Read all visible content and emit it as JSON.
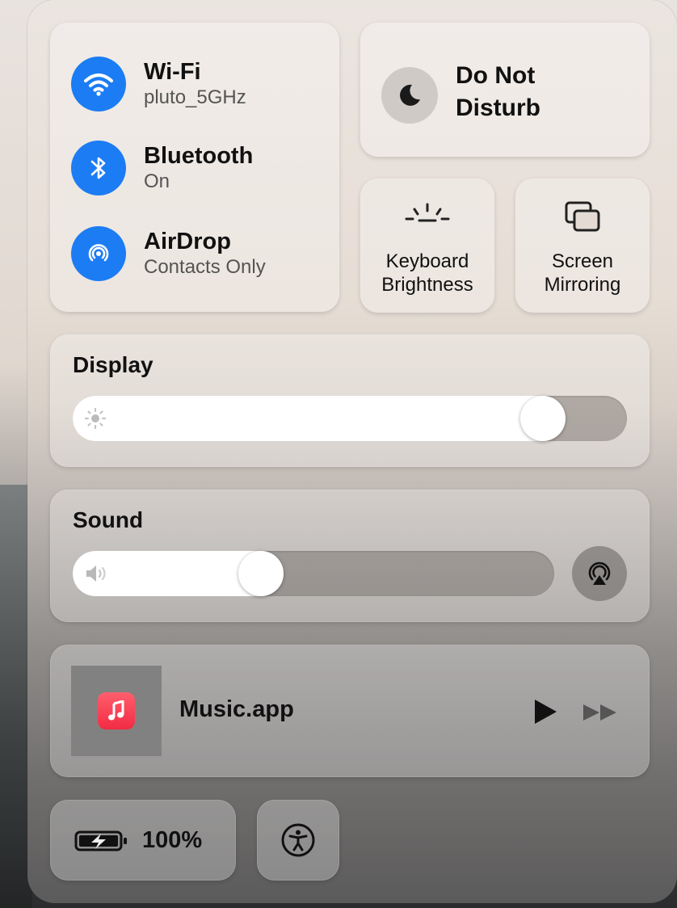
{
  "network": {
    "wifi": {
      "title": "Wi-Fi",
      "subtitle": "pluto_5GHz",
      "icon": "wifi-icon"
    },
    "bluetooth": {
      "title": "Bluetooth",
      "subtitle": "On",
      "icon": "bluetooth-icon"
    },
    "airdrop": {
      "title": "AirDrop",
      "subtitle": "Contacts Only",
      "icon": "airdrop-icon"
    }
  },
  "do_not_disturb": {
    "label": "Do Not Disturb",
    "line1": "Do Not",
    "line2": "Disturb",
    "icon": "moon-icon"
  },
  "keyboard_brightness": {
    "line1": "Keyboard",
    "line2": "Brightness",
    "icon": "keyboard-brightness-icon"
  },
  "screen_mirroring": {
    "line1": "Screen",
    "line2": "Mirroring",
    "icon": "screen-mirroring-icon"
  },
  "display": {
    "title": "Display",
    "brightness_level": 0.88,
    "icon": "sun-icon"
  },
  "sound": {
    "title": "Sound",
    "volume_level": 0.38,
    "icon": "speaker-icon",
    "airplay_icon": "airplay-audio-icon"
  },
  "now_playing": {
    "title": "Music.app",
    "icon": "music-app-icon",
    "play_icon": "play-icon",
    "next_icon": "fast-forward-icon"
  },
  "battery": {
    "percent": "100%",
    "icon": "battery-charging-icon"
  },
  "accessibility": {
    "icon": "accessibility-icon"
  },
  "colors": {
    "accent": "#1c7cf4",
    "music_red": "#f22b43"
  }
}
